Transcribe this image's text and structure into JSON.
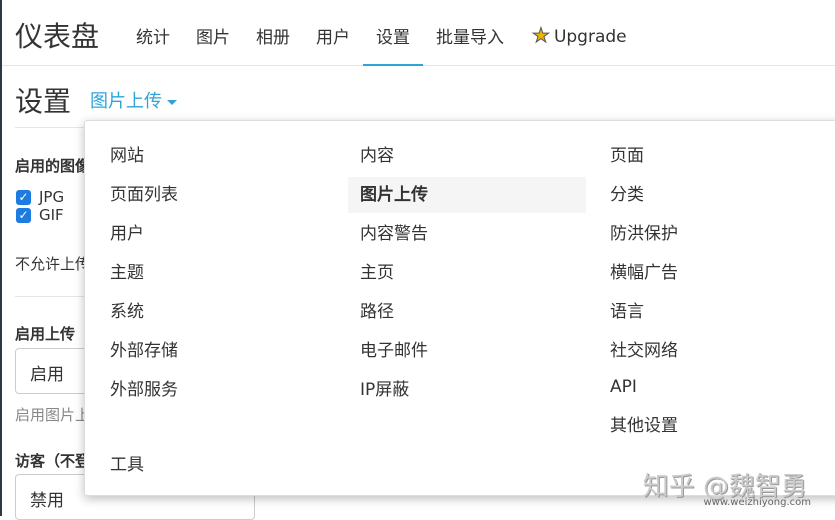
{
  "nav": {
    "brand": "仪表盘",
    "items": [
      "统计",
      "图片",
      "相册",
      "用户",
      "设置",
      "批量导入"
    ],
    "upgrade": "Upgrade",
    "active": "设置"
  },
  "page": {
    "title": "设置",
    "subsection": "图片上传"
  },
  "form": {
    "enabled_types_label": "启用的图像",
    "types": [
      "JPG",
      "GIF"
    ],
    "disallow_text": "不允许上传",
    "enable_upload_label": "启用上传",
    "enable_upload_value": "启用",
    "enable_upload_hint": "启用图片上传",
    "guest_label": "访客（不登录",
    "guest_value": "禁用"
  },
  "menu": {
    "col1": [
      "网站",
      "页面列表",
      "用户",
      "主题",
      "系统",
      "外部存储",
      "外部服务",
      "工具"
    ],
    "col2": [
      "内容",
      "图片上传",
      "内容警告",
      "主页",
      "路径",
      "电子邮件",
      "IP屏蔽"
    ],
    "col3": [
      "页面",
      "分类",
      "防洪保护",
      "横幅广告",
      "语言",
      "社交网络",
      "API",
      "其他设置"
    ],
    "active": "图片上传"
  },
  "watermark": {
    "text": "知乎 @魏智勇",
    "url": "www.weizhiyong.com"
  }
}
